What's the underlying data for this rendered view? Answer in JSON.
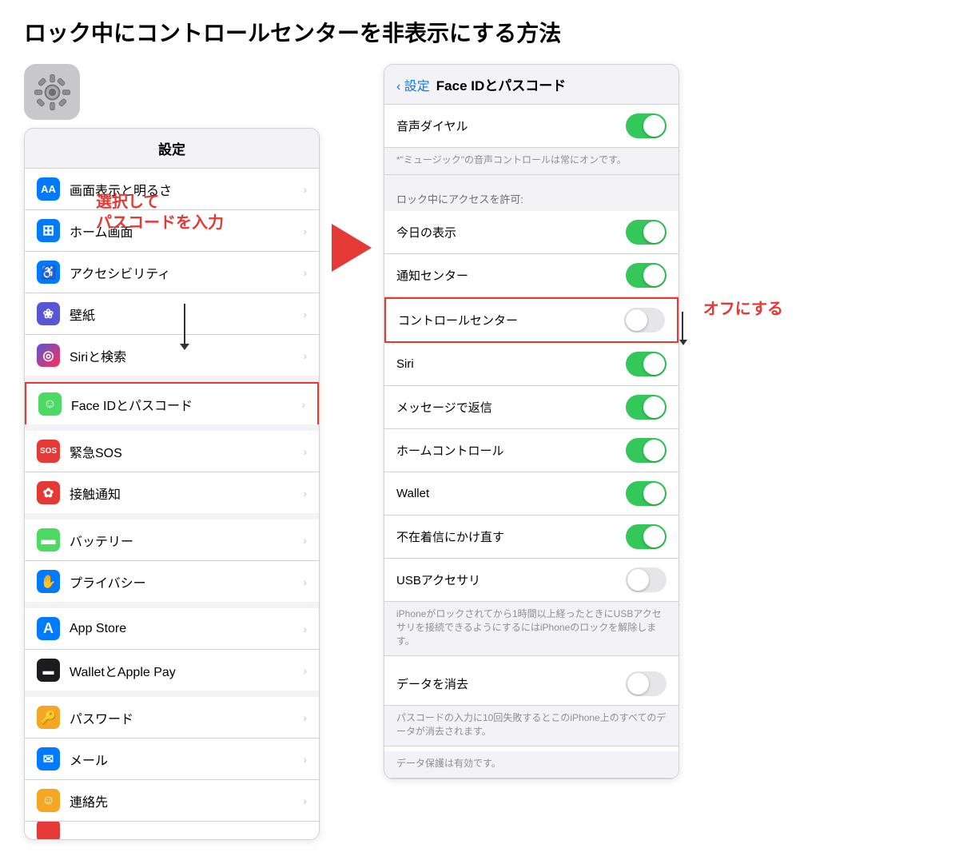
{
  "title": "ロック中にコントロールセンターを非表示にする方法",
  "left_panel": {
    "header": "設定",
    "groups": [
      {
        "items": [
          {
            "id": "display",
            "icon_bg": "#007aff",
            "icon_text": "AA",
            "label": "画面表示と明るさ"
          },
          {
            "id": "home",
            "icon_bg": "#007aff",
            "icon_text": "⊞",
            "label": "ホーム画面"
          },
          {
            "id": "accessibility",
            "icon_bg": "#007aff",
            "icon_text": "♿",
            "label": "アクセシビリティ"
          },
          {
            "id": "wallpaper",
            "icon_bg": "#5856d6",
            "icon_text": "❀",
            "label": "壁紙"
          },
          {
            "id": "siri",
            "icon_bg": "#333",
            "icon_text": "◎",
            "label": "Siriと検索"
          }
        ]
      },
      {
        "items": [
          {
            "id": "faceid",
            "icon_bg": "#4cd964",
            "icon_text": "☺",
            "label": "Face IDとパスコード",
            "highlight": true
          }
        ]
      },
      {
        "items": [
          {
            "id": "sos",
            "icon_bg": "#e53935",
            "icon_text": "SOS",
            "label": "緊急SOS"
          },
          {
            "id": "contact",
            "icon_bg": "#e53935",
            "icon_text": "✿",
            "label": "接触通知"
          }
        ]
      },
      {
        "items": [
          {
            "id": "battery",
            "icon_bg": "#4cd964",
            "icon_text": "▬",
            "label": "バッテリー"
          },
          {
            "id": "privacy",
            "icon_bg": "#007aff",
            "icon_text": "✋",
            "label": "プライバシー"
          }
        ]
      },
      {
        "items": [
          {
            "id": "appstore",
            "icon_bg": "#007aff",
            "icon_text": "A",
            "label": "App Store"
          },
          {
            "id": "wallet",
            "icon_bg": "#1c1c1e",
            "icon_text": "▬",
            "label": "WalletとApple Pay"
          }
        ]
      },
      {
        "items": [
          {
            "id": "password",
            "icon_bg": "#f5a623",
            "icon_text": "🔑",
            "label": "パスワード"
          },
          {
            "id": "mail",
            "icon_bg": "#007aff",
            "icon_text": "✉",
            "label": "メール"
          },
          {
            "id": "contacts",
            "icon_bg": "#f5a623",
            "icon_text": "☺",
            "label": "連絡先"
          }
        ]
      }
    ]
  },
  "annotation_select": "選択して",
  "annotation_passcode": "パスコードを入力",
  "annotation_off": "オフにする",
  "right_panel": {
    "back_label": "設定",
    "title": "Face IDとパスコード",
    "rows": [
      {
        "id": "voice_dial",
        "label": "音声ダイヤル",
        "toggle": "on"
      },
      {
        "id": "note1",
        "type": "note",
        "text": "*\"ミュージック\"の音声コントロールは常にオンです。"
      },
      {
        "id": "section_lock",
        "type": "section_header",
        "text": "ロック中にアクセスを許可:"
      },
      {
        "id": "today",
        "label": "今日の表示",
        "toggle": "on"
      },
      {
        "id": "notification_center",
        "label": "通知センター",
        "toggle": "on"
      },
      {
        "id": "control_center",
        "label": "コントロールセンター",
        "toggle": "off",
        "highlight": true
      },
      {
        "id": "siri",
        "label": "Siri",
        "toggle": "on"
      },
      {
        "id": "messages",
        "label": "メッセージで返信",
        "toggle": "on"
      },
      {
        "id": "home_control",
        "label": "ホームコントロール",
        "toggle": "on"
      },
      {
        "id": "wallet",
        "label": "Wallet",
        "toggle": "on"
      },
      {
        "id": "missed_call",
        "label": "不在着信にかけ直す",
        "toggle": "on"
      },
      {
        "id": "usb",
        "label": "USBアクセサリ",
        "toggle": "off"
      },
      {
        "id": "usb_note",
        "type": "note",
        "text": "iPhoneがロックされてから1時間以上経ったときにUSBアクセサリを接続できるようにするにはiPhoneのロックを解除します。"
      },
      {
        "id": "erase_data",
        "label": "データを消去",
        "toggle": "off"
      },
      {
        "id": "erase_note",
        "type": "note",
        "text": "パスコードの入力に10回失敗するとこのiPhone上のすべてのデータが消去されます。"
      },
      {
        "id": "data_protection",
        "type": "note",
        "text": "データ保護は有効です。"
      }
    ]
  }
}
